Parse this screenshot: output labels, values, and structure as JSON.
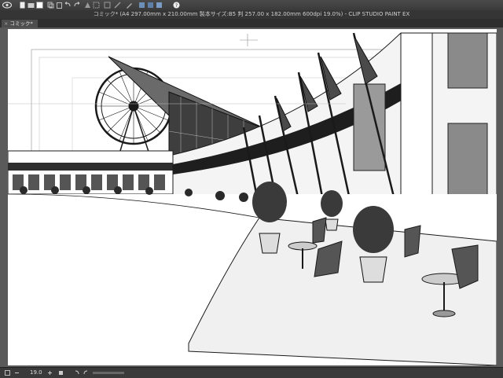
{
  "title": "コミック* (A4 297.00mm x 210.00mm 製本サイズ:B5 判 257.00 x 182.00mm 600dpi 19.0%) - CLIP STUDIO PAINT EX",
  "tab_label": "コミック*",
  "zoom": "19.0",
  "toolbar_icons": [
    "app-menu-icon",
    "new-icon",
    "open-icon",
    "save-icon",
    "copy-icon",
    "paste-icon",
    "undo-icon",
    "redo-icon",
    "fill-icon",
    "transform-icon",
    "selection-icon",
    "ruler-icon",
    "pen-icon",
    "fill-bucket-icon",
    "eraser-icon",
    "blend-icon",
    "gradient-icon",
    "help-icon"
  ],
  "colors": {
    "chrome": "#3c3c3c",
    "titlebar": "#353535",
    "canvas_bg": "#5a5a5a",
    "paper": "#ffffff",
    "ink": "#1a1a1a"
  }
}
